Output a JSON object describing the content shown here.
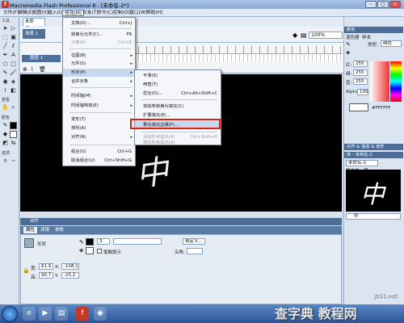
{
  "window": {
    "title": "Macromedia Flash Professional 8 - [未命名-2*]",
    "app_icon": "f"
  },
  "menubar": [
    "文件(F)",
    "编辑(E)",
    "视图(V)",
    "插入(I)",
    "修改(M)",
    "文本(T)",
    "命令(C)",
    "控制(O)",
    "窗口(W)",
    "帮助(H)"
  ],
  "toolbox": {
    "section_tools": "工具",
    "section_view": "查看",
    "section_colors": "颜色",
    "section_options": "选项",
    "icons": [
      "arrow-icon",
      "subselect-icon",
      "line-icon",
      "lasso-icon",
      "pen-icon",
      "text-icon",
      "oval-icon",
      "rect-icon",
      "pencil-icon",
      "brush-icon",
      "free-transform-icon",
      "fill-transform-icon",
      "ink-bottle-icon",
      "paint-bucket-icon",
      "eyedropper-icon",
      "eraser-icon"
    ]
  },
  "document": {
    "tab": "未命名-2*",
    "scene": "场景 1",
    "zoom": "100%",
    "layer": "图层 1",
    "stage_text": "中"
  },
  "modify_menu": {
    "items": [
      {
        "label": "文档(D)...",
        "shortcut": "Ctrl+J",
        "submenu": false,
        "disabled": false
      },
      {
        "label": "转换为元件(C)...",
        "shortcut": "F8",
        "submenu": false,
        "disabled": false
      },
      {
        "label": "分离(K)",
        "shortcut": "Ctrl+B",
        "submenu": false,
        "disabled": true
      },
      {
        "label": "位图(B)",
        "shortcut": "",
        "submenu": true,
        "disabled": false
      },
      {
        "label": "元件(S)",
        "shortcut": "",
        "submenu": true,
        "disabled": false
      },
      {
        "label": "形状(P)",
        "shortcut": "",
        "submenu": true,
        "disabled": false,
        "highlighted": true
      },
      {
        "label": "合并对象",
        "shortcut": "",
        "submenu": true,
        "disabled": false
      },
      {
        "label": "时间轴(M)",
        "shortcut": "",
        "submenu": true,
        "disabled": false
      },
      {
        "label": "时间轴特效(E)",
        "shortcut": "",
        "submenu": true,
        "disabled": false
      },
      {
        "label": "变形(T)",
        "shortcut": "",
        "submenu": true,
        "disabled": false
      },
      {
        "label": "排列(A)",
        "shortcut": "",
        "submenu": true,
        "disabled": false
      },
      {
        "label": "对齐(N)",
        "shortcut": "",
        "submenu": true,
        "disabled": false
      },
      {
        "label": "组合(G)",
        "shortcut": "Ctrl+G",
        "submenu": false,
        "disabled": false
      },
      {
        "label": "取消组合(U)",
        "shortcut": "Ctrl+Shift+G",
        "submenu": false,
        "disabled": false
      }
    ]
  },
  "shape_submenu": {
    "items": [
      {
        "label": "平滑(S)",
        "shortcut": "",
        "disabled": false
      },
      {
        "label": "伸直(T)",
        "shortcut": "",
        "disabled": false
      },
      {
        "label": "优化(O)...",
        "shortcut": "Ctrl+Alt+Shift+C",
        "disabled": false
      },
      {
        "label": "将线条转换为填充(C)",
        "shortcut": "",
        "disabled": false
      },
      {
        "label": "扩展填充(E)...",
        "shortcut": "",
        "disabled": false
      },
      {
        "label": "柔化填充边缘(F)...",
        "shortcut": "",
        "disabled": false,
        "highlighted": true
      },
      {
        "label": "添加形状提示(A)",
        "shortcut": "Ctrl+Shift+H",
        "disabled": true
      },
      {
        "label": "删除所有提示(R)",
        "shortcut": "",
        "disabled": true
      }
    ]
  },
  "actions_panel": "动作",
  "properties": {
    "tabs": [
      "属性",
      "滤镜",
      "参数"
    ],
    "type_label": "形状",
    "custom_label": "自定义...",
    "cap_label": "尖角:",
    "hint_label": "笔触提示",
    "width_label": "宽:",
    "height_label": "高:",
    "x_label": "X:",
    "y_label": "Y:",
    "width": "61.9",
    "height": "90.7",
    "x": "-108.1",
    "y": "-25.2",
    "stroke_value": "3",
    "color_hex": "#FFFFFF"
  },
  "right_panel": {
    "color_panel": "颜色",
    "mixer_tab": "混色器",
    "swatches_tab": "样本",
    "type_label": "类型:",
    "type_value": "纯色",
    "r_label": "红:",
    "g_label": "绿:",
    "b_label": "蓝:",
    "r": "255",
    "g": "255",
    "b": "255",
    "alpha_label": "Alpha:",
    "alpha": "100%",
    "hex": "#FFFFFF",
    "align_panel": "对齐 & 信息 & 变形",
    "library_panel": "库 - 未命名-2",
    "library_doc": "未命名-2",
    "library_count": "库中的一项",
    "library_item": "中",
    "watermark_url": "jb51.net"
  },
  "taskbar": {
    "time": "",
    "watermark": "查字典 教程网"
  },
  "colors": {
    "stage": "#000000",
    "highlight_box": "#e02010",
    "panel_header": "#4b6d97"
  }
}
